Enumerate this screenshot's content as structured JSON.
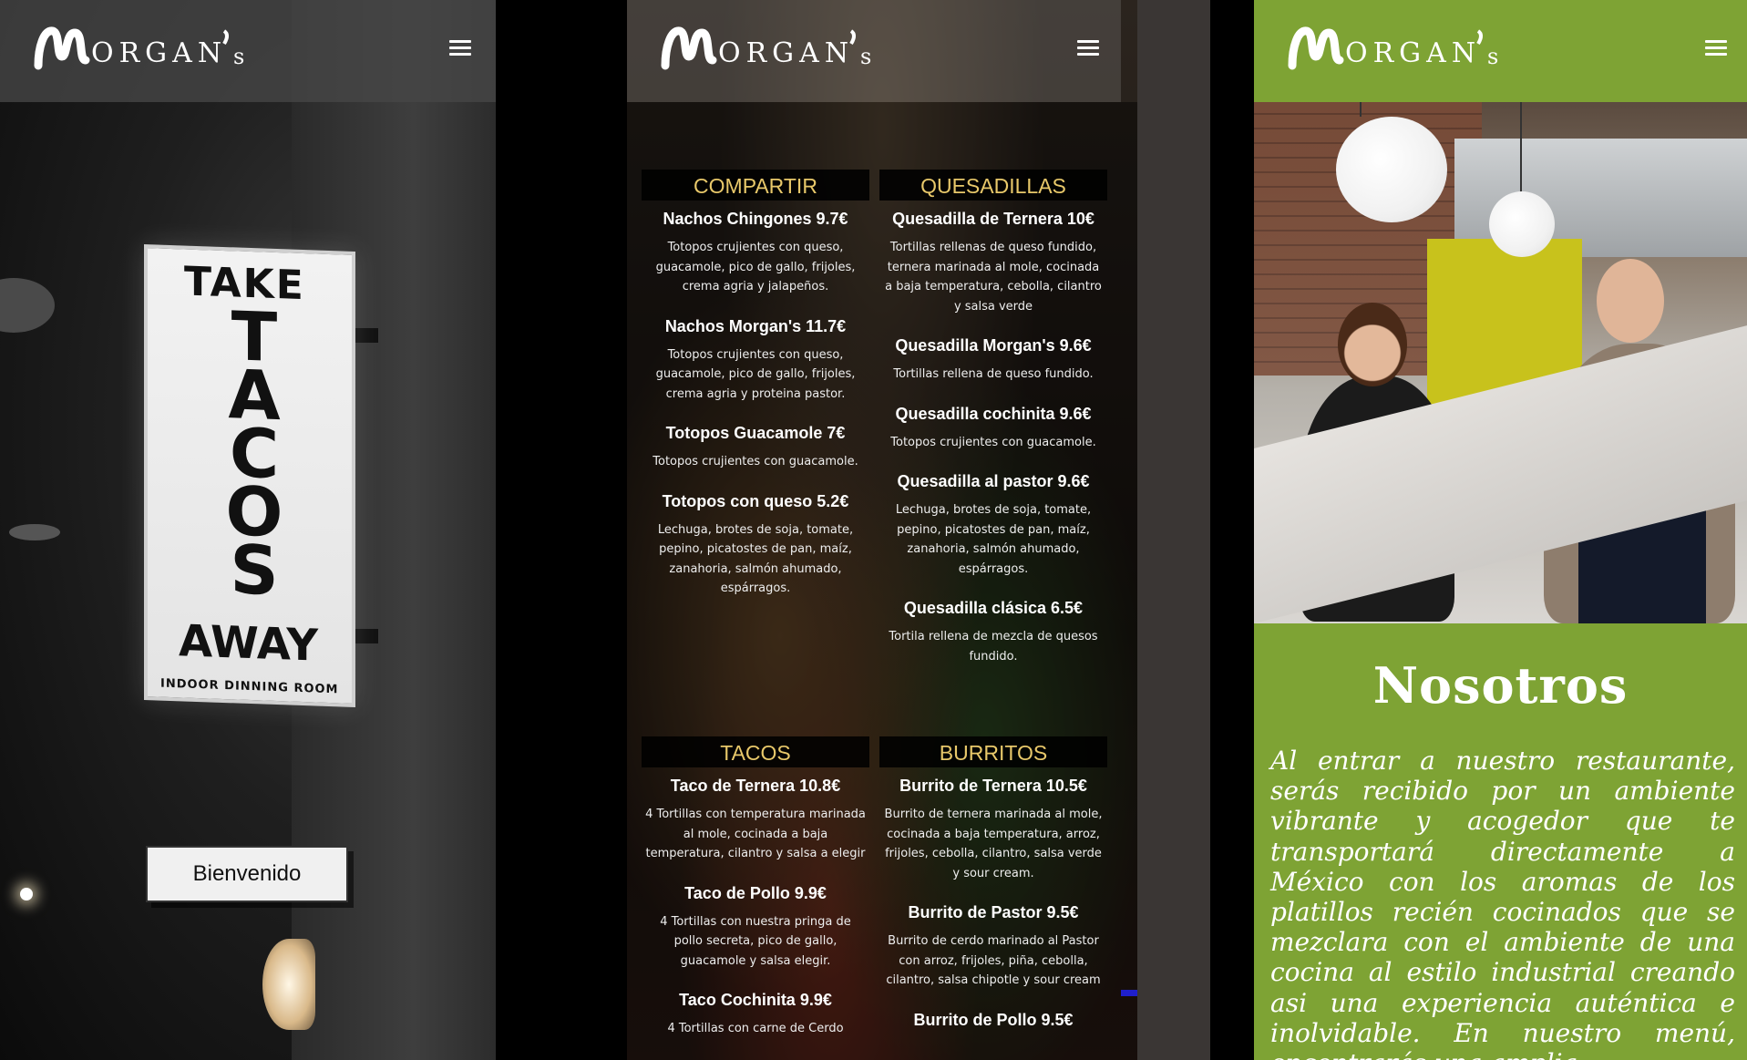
{
  "brand": {
    "logo_text": "Morgan's"
  },
  "panel1": {
    "sign": {
      "take": "TAKE",
      "tacos": "TACOS",
      "away": "AWAY",
      "sub": "INDOOR DINNING ROOM"
    },
    "welcome_button": "Bienvenido"
  },
  "panel2": {
    "columns": [
      {
        "category": "COMPARTIR",
        "items": [
          {
            "name": "Nachos Chingones 9.7€",
            "desc": "Totopos crujientes con queso, guacamole, pico de gallo, frijoles, crema agria y jalapeños."
          },
          {
            "name": "Nachos Morgan's 11.7€",
            "desc": "Totopos crujientes con queso, guacamole, pico de gallo, frijoles, crema agria y proteina pastor."
          },
          {
            "name": "Totopos Guacamole 7€",
            "desc": "Totopos crujientes con guacamole."
          },
          {
            "name": "Totopos con queso 5.2€",
            "desc": "Lechuga, brotes de soja, tomate, pepino, picatostes de pan, maíz, zanahoria, salmón ahumado, espárragos."
          }
        ]
      },
      {
        "category": "QUESADILLAS",
        "items": [
          {
            "name": "Quesadilla de Ternera 10€",
            "desc": "Tortillas rellenas de queso fundido, ternera marinada al mole, cocinada a baja temperatura, cebolla, cilantro y salsa verde"
          },
          {
            "name": "Quesadilla Morgan's 9.6€",
            "desc": "Tortillas rellena de queso fundido."
          },
          {
            "name": "Quesadilla cochinita 9.6€",
            "desc": "Totopos crujientes con guacamole."
          },
          {
            "name": "Quesadilla al pastor 9.6€",
            "desc": "Lechuga, brotes de soja, tomate, pepino, picatostes de pan, maíz, zanahoria, salmón ahumado, espárragos."
          },
          {
            "name": "Quesadilla clásica 6.5€",
            "desc": "Tortila rellena de mezcla de quesos fundido."
          }
        ]
      },
      {
        "category": "TACOS",
        "items": [
          {
            "name": "Taco de Ternera 10.8€",
            "desc": "4 Tortillas con temperatura marinada al mole, cocinada a baja temperatura, cilantro y salsa a elegir"
          },
          {
            "name": "Taco de Pollo 9.9€",
            "desc": "4 Tortillas con nuestra pringa de pollo secreta, pico de gallo, guacamole y salsa elegir."
          },
          {
            "name": "Taco Cochinita 9.9€",
            "desc": "4 Tortillas con carne de Cerdo"
          }
        ]
      },
      {
        "category": "BURRITOS",
        "items": [
          {
            "name": "Burrito de Ternera 10.5€",
            "desc": "Burrito de ternera marinada al mole, cocinada a baja temperatura, arroz, frijoles, cebolla, cilantro, salsa verde y sour cream."
          },
          {
            "name": "Burrito de Pastor 9.5€",
            "desc": "Burrito de cerdo marinado al Pastor con arroz, frijoles, piña, cebolla, cilantro, salsa chipotle y sour cream"
          },
          {
            "name": "Burrito de Pollo 9.5€",
            "desc": ""
          }
        ]
      }
    ]
  },
  "panel3": {
    "title": "Nosotros",
    "text": "Al entrar a nuestro restaurante, serás recibido por un ambiente vibrante y acogedor que te transportará directamente a México con los aromas de los platillos recién cocinados que se mezclara con el ambiente de una cocina al estilo industrial creando asi una experiencia auténtica e inolvidable. En nuestro menú, encontrarás una amplia"
  },
  "colors": {
    "accent_green": "#7ea334",
    "menu_heading": "#e8c86a"
  },
  "icons": {
    "menu": "hamburger-menu-icon"
  }
}
